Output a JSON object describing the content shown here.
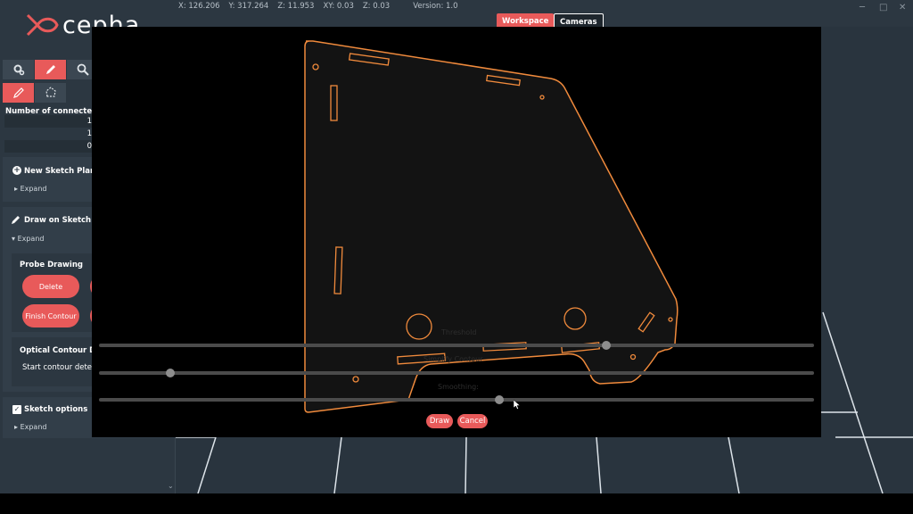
{
  "app": {
    "logo_text": "cepha",
    "coords": {
      "x": "X: 126.206",
      "y": "Y: 317.264",
      "z": "Z: 11.953",
      "xy": "XY: 0.03",
      "zz": "Z: 0.03"
    },
    "version": "Version: 1.0",
    "tabs": {
      "workspace": "Workspace",
      "cameras": "Cameras"
    }
  },
  "sidebar": {
    "table_header": "Number of connecte",
    "table_values": [
      "1",
      "1",
      "0"
    ],
    "new_sketch_plane": {
      "title": "New Sketch Plane",
      "expand": "Expand"
    },
    "draw_on_sketch_plane": {
      "title": "Draw on Sketch Plan",
      "expand": "Expand"
    },
    "probe_drawing": {
      "title": "Probe Drawing",
      "delete": "Delete",
      "finish_contour": "Finish Contour"
    },
    "optical_contour": {
      "title": "Optical Contour Dete",
      "text": "Start contour detectio"
    },
    "sketch_options": {
      "title": "Sketch options",
      "expand": "Expand"
    }
  },
  "dialog": {
    "sliders": [
      {
        "label": "Threshold",
        "value": 0.71
      },
      {
        "label": "Simplify Contour",
        "value": 0.1
      },
      {
        "label": "Smoothing:",
        "value": 0.56
      }
    ],
    "draw": "Draw",
    "cancel": "Cancel"
  },
  "colors": {
    "accent": "#e85a5a",
    "contour": "#f08a3c",
    "background": "#2c3741"
  }
}
